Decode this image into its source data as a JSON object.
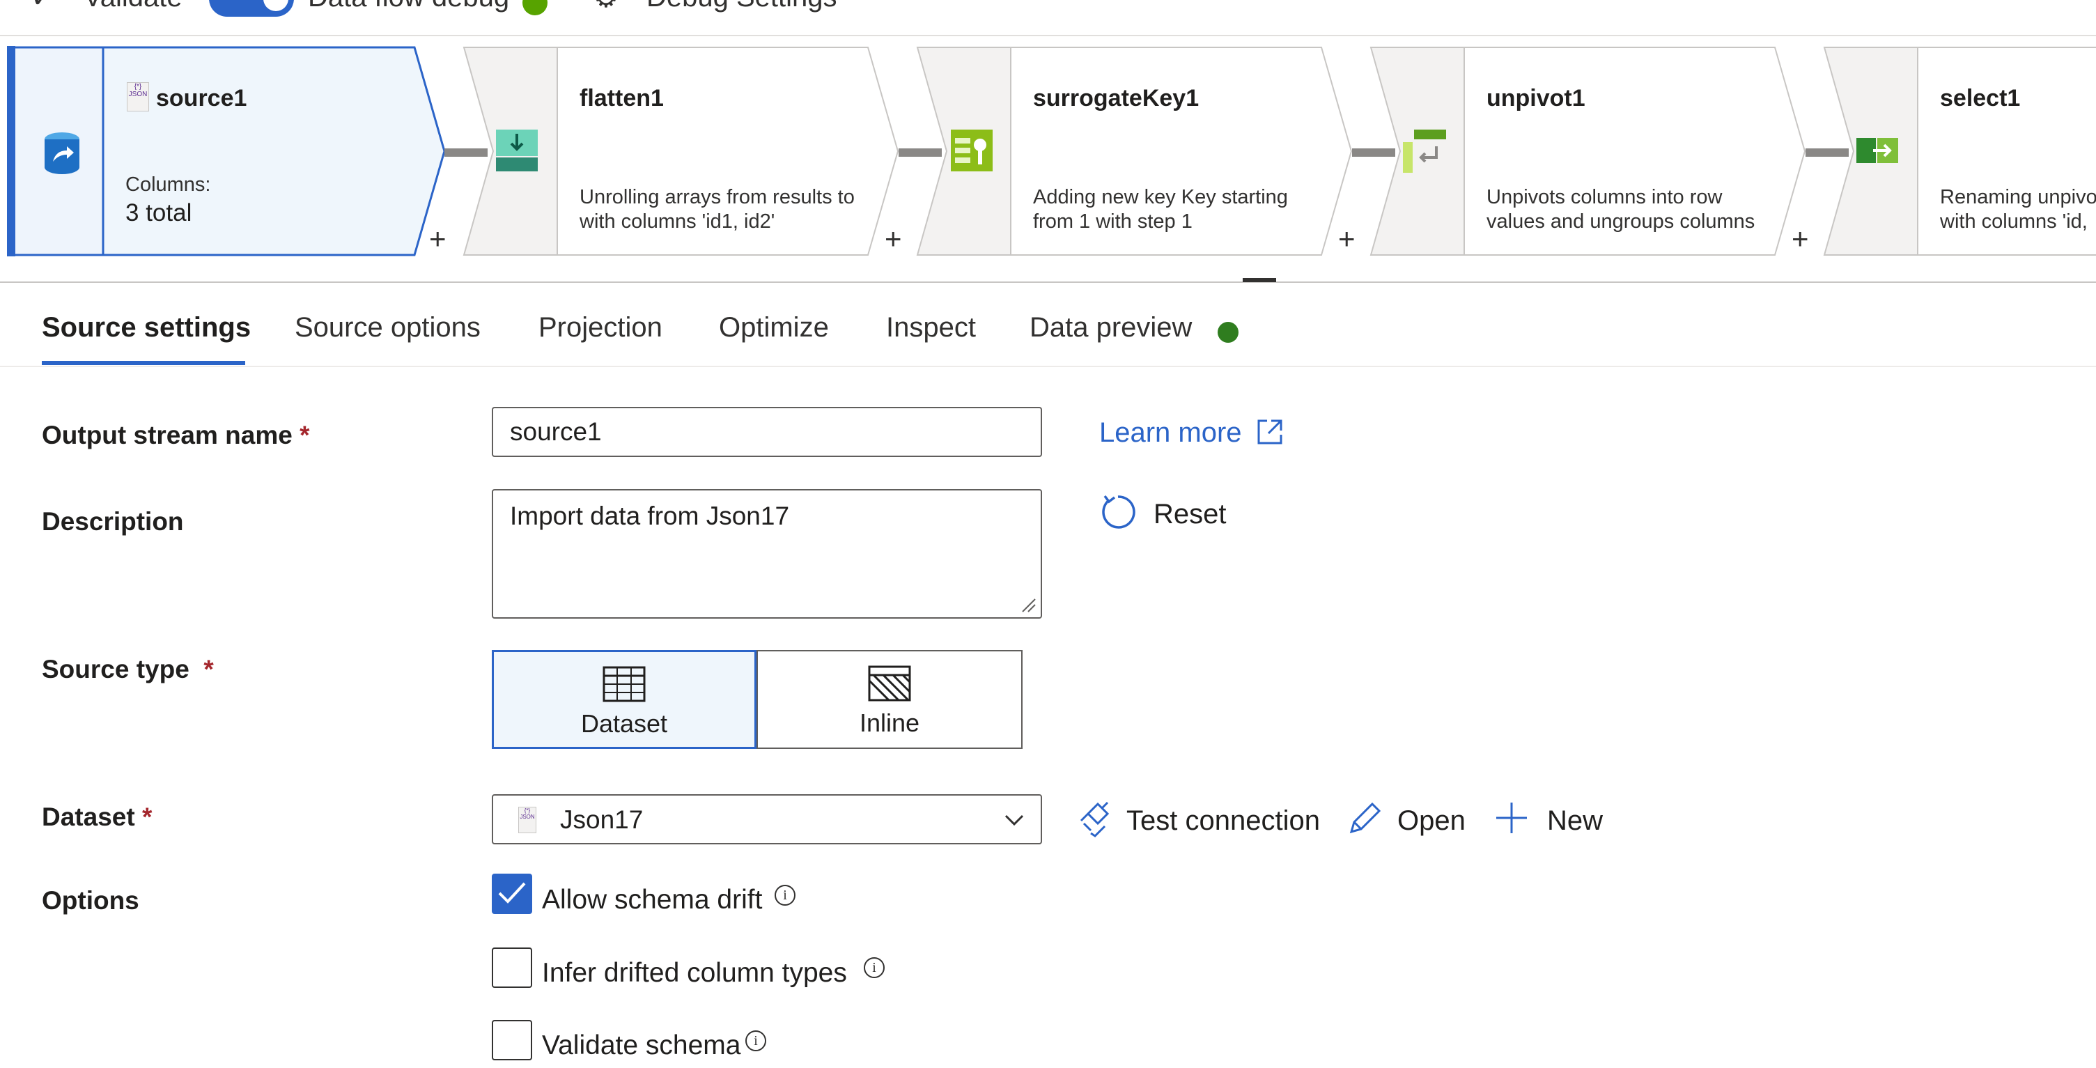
{
  "toolbar": {
    "validate": "Validate",
    "data_flow_debug": "Data flow debug",
    "debug_settings": "Debug Settings"
  },
  "flow": {
    "nodes": [
      {
        "title": "source1",
        "icon": "json-source-icon",
        "columns_label": "Columns:",
        "columns_value": "3 total"
      },
      {
        "title": "flatten1",
        "icon": "flatten-icon",
        "desc_line1": "Unrolling arrays from results to",
        "desc_line2": "with columns 'id1, id2'"
      },
      {
        "title": "surrogateKey1",
        "icon": "surrogate-key-icon",
        "desc_line1": "Adding new key Key starting",
        "desc_line2": "from 1 with step 1"
      },
      {
        "title": "unpivot1",
        "icon": "unpivot-icon",
        "desc_line1": "Unpivots columns into row",
        "desc_line2": "values and ungroups columns"
      },
      {
        "title": "select1",
        "icon": "select-icon",
        "desc_line1": "Renaming unpivo",
        "desc_line2": "with columns 'id,"
      }
    ],
    "add_label": "+"
  },
  "tabs": [
    {
      "label": "Source settings",
      "active": true
    },
    {
      "label": "Source options"
    },
    {
      "label": "Projection"
    },
    {
      "label": "Optimize"
    },
    {
      "label": "Inspect"
    },
    {
      "label": "Data preview"
    }
  ],
  "form": {
    "output_stream": {
      "label": "Output stream name",
      "required": "*",
      "value": "source1"
    },
    "learn_more": "Learn more",
    "description": {
      "label": "Description",
      "value": "Import data from Json17"
    },
    "reset": "Reset",
    "source_type": {
      "label": "Source type",
      "required": "*",
      "options": [
        "Dataset",
        "Inline"
      ],
      "selected": "Dataset"
    },
    "dataset": {
      "label": "Dataset",
      "required": "*",
      "value": "Json17"
    },
    "dataset_actions": {
      "test_connection": "Test connection",
      "open": "Open",
      "new": "New"
    },
    "options": {
      "label": "Options",
      "items": [
        {
          "label": "Allow schema drift",
          "checked": true
        },
        {
          "label": "Infer drifted column types",
          "checked": false
        },
        {
          "label": "Validate schema",
          "checked": false
        }
      ]
    }
  },
  "colors": {
    "accent": "#2b64c8",
    "selected_bg": "#eff6fc",
    "success": "#57a300"
  }
}
